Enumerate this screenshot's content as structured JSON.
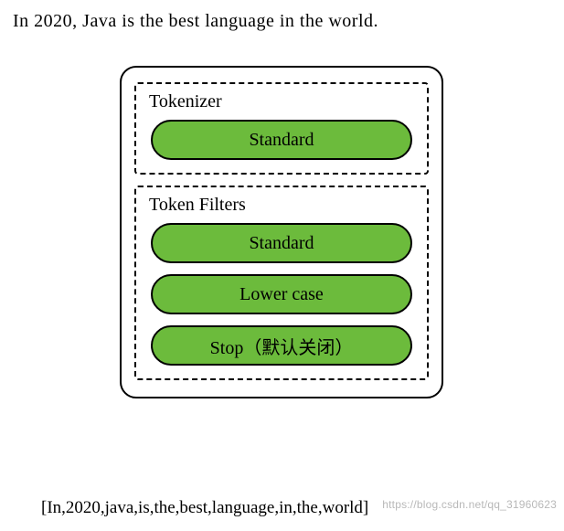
{
  "input_sentence": "In 2020, Java is the best language in the world.",
  "analyzer": {
    "tokenizer": {
      "title": "Tokenizer",
      "items": [
        "Standard"
      ]
    },
    "token_filters": {
      "title": "Token Filters",
      "items": [
        "Standard",
        "Lower case",
        "Stop（默认关闭）"
      ]
    }
  },
  "output_tokens": "[In,2020,java,is,the,best,language,in,the,world]",
  "watermark": "https://blog.csdn.net/qq_31960623"
}
